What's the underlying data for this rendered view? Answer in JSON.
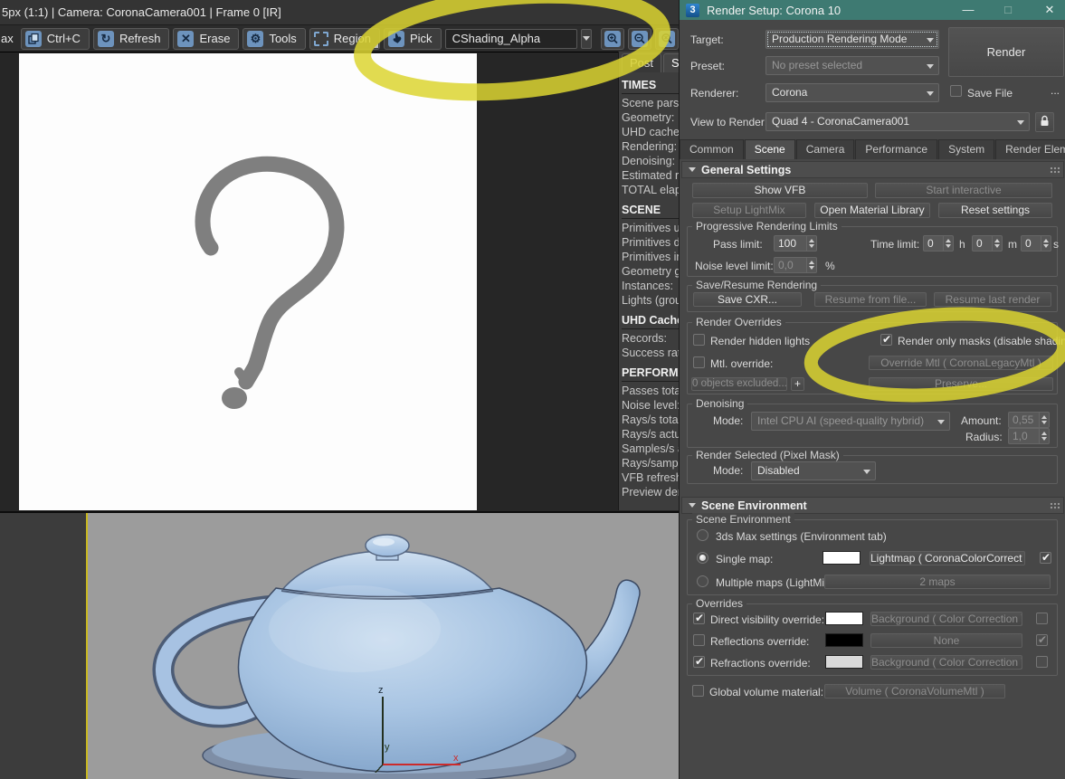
{
  "colors": {
    "titlebar_teal": "#3e7a72",
    "marker_yellow": "#dcd531",
    "icon_blue": "#6d93bd",
    "viewport_bg": "#9c9c9c",
    "teapot_blue": "#a9c5e3",
    "axis_x_red": "#cc2a2a"
  },
  "info_bar": {
    "text": "5px (1:1) | Camera: CoronaCamera001 | Frame 0 [IR]"
  },
  "toolbar": {
    "cutoff_label": "ax",
    "copy_label": "Ctrl+C",
    "refresh_label": "Refresh",
    "erase_label": "Erase",
    "tools_label": "Tools",
    "region_label": "Region",
    "pick_label": "Pick",
    "channel_value": "CShading_Alpha",
    "icons": [
      "copy-icon",
      "refresh-icon",
      "erase-icon",
      "gear-icon",
      "region-icon",
      "pick-hand-icon",
      "zoom-in-icon",
      "zoom-out-icon",
      "zoom-reset-icon"
    ]
  },
  "stats_panel": {
    "tab_post": "Post",
    "tab_stats": "Stats",
    "sections": [
      {
        "title": "TIMES",
        "items": [
          "Scene parsin",
          "Geometry:",
          "UHD cache",
          "Rendering:",
          "Denoising:",
          "Estimated re",
          "TOTAL elaps"
        ]
      },
      {
        "title": "SCENE",
        "items": [
          "Primitives u",
          "Primitives d",
          "Primitives in",
          "Geometry g",
          "Instances:",
          "Lights (grou"
        ]
      },
      {
        "title": "UHD Cache",
        "items": [
          "Records:",
          "Success rate"
        ]
      },
      {
        "title": "PERFORMA",
        "items": [
          "Passes total:",
          "Noise level:",
          "Rays/s total:",
          "Rays/s actua",
          "Samples/s a",
          "Rays/sampl",
          "VFB refresh",
          "Preview den"
        ]
      }
    ]
  },
  "dialog": {
    "title": "Render Setup: Corona 10",
    "logo": "3",
    "minimize_glyph": "—",
    "maximize_glyph": "□",
    "close_glyph": "✕",
    "target_label": "Target:",
    "target_value": "Production Rendering Mode",
    "preset_label": "Preset:",
    "preset_value": "No preset selected",
    "renderer_label": "Renderer:",
    "renderer_value": "Corona",
    "save_file_label": "Save File",
    "more_label": "...",
    "view_label": "View to Render:",
    "view_value": "Quad 4 - CoronaCamera001",
    "render_button": "Render",
    "tabs": [
      "Common",
      "Scene",
      "Camera",
      "Performance",
      "System",
      "Render Elements"
    ],
    "active_tab": "Scene"
  },
  "general": {
    "header": "General Settings",
    "show_vfb": "Show VFB",
    "start_interactive": "Start interactive",
    "setup_lightmix": "Setup LightMix",
    "open_material_library": "Open Material Library",
    "reset_settings": "Reset settings",
    "progressive": {
      "legend": "Progressive Rendering Limits",
      "pass_limit_label": "Pass limit:",
      "pass_limit_value": "100",
      "time_limit_label": "Time limit:",
      "time_h_value": "0",
      "h_label": "h",
      "time_m_value": "0",
      "m_label": "m",
      "time_s_value": "0",
      "s_label": "s",
      "noise_label": "Noise level limit:",
      "noise_value": "0,0",
      "percent_label": "%"
    },
    "save_resume": {
      "legend": "Save/Resume Rendering",
      "save_cxr": "Save CXR...",
      "resume_file": "Resume from file...",
      "resume_last": "Resume last render"
    },
    "overrides": {
      "legend": "Render Overrides",
      "render_hidden_lights": "Render hidden lights",
      "render_only_masks": "Render only masks (disable shading)",
      "mtl_override": "Mtl. override:",
      "override_mtl": "Override Mtl  ( CoronaLegacyMtl )",
      "objects_excluded": "0 objects excluded...",
      "plus": "+",
      "preserve": "Preserve..."
    },
    "denoising": {
      "legend": "Denoising",
      "mode_label": "Mode:",
      "mode_value": "Intel CPU AI (speed-quality hybrid)",
      "amount_label": "Amount:",
      "amount_value": "0,55",
      "radius_label": "Radius:",
      "radius_value": "1,0"
    },
    "render_selected": {
      "legend": "Render Selected (Pixel Mask)",
      "mode_label": "Mode:",
      "mode_value": "Disabled"
    }
  },
  "environment": {
    "header": "Scene Environment",
    "group_legend": "Scene Environment",
    "radio_max": "3ds Max settings (Environment tab)",
    "radio_single": "Single map:",
    "single_button": "Lightmap  ( CoronaColorCorrect )",
    "radio_multiple": "Multiple maps (LightMix):",
    "multiple_button": "2 maps",
    "overrides_legend": "Overrides",
    "direct_label": "Direct visibility override:",
    "direct_button": "Background  ( Color Correction )",
    "reflections_label": "Reflections override:",
    "reflections_button": "None",
    "refractions_label": "Refractions override:",
    "refractions_button": "Background  ( Color Correction )",
    "global_label": "Global volume material:",
    "global_button": "Volume  ( CoronaVolumeMtl )",
    "swatches": {
      "single": "#ffffff",
      "direct": "#ffffff",
      "reflections": "#000000",
      "refractions": "#d9d9d9"
    }
  },
  "viewport": {
    "axis_x": "x",
    "axis_y": "y",
    "axis_z": "z"
  }
}
